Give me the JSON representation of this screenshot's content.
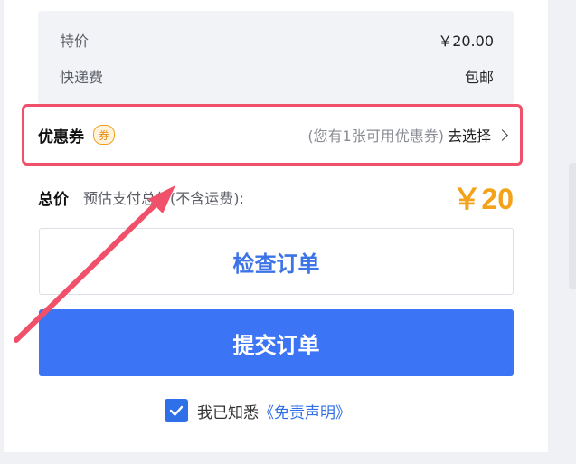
{
  "summary": {
    "price_label": "特价",
    "price_value": "￥20.00",
    "shipping_label": "快递费",
    "shipping_value": "包邮"
  },
  "coupon": {
    "label": "优惠券",
    "tag": "券",
    "hint": "(您有1张可用优惠券)",
    "action": "去选择"
  },
  "total": {
    "label": "总价",
    "note": "预估支付总价(不含运费):",
    "amount": "￥20"
  },
  "buttons": {
    "check_order": "检查订单",
    "submit_order": "提交订单"
  },
  "agreement": {
    "checked": true,
    "text": "我已知悉",
    "link": "《免责声明》"
  },
  "colors": {
    "accent_blue": "#3b74f5",
    "price_orange": "#f3a21b",
    "highlight_red": "#f0506a"
  }
}
